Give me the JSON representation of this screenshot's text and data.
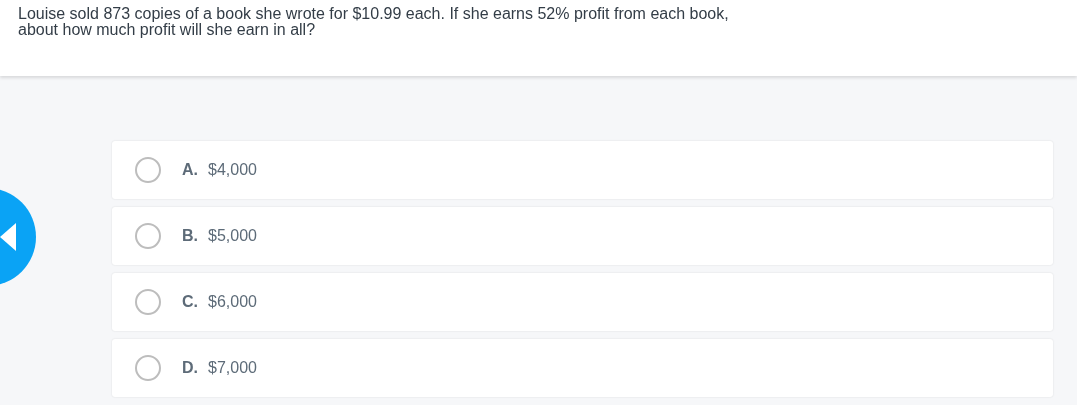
{
  "question": "Louise sold 873 copies of a book she wrote for $10.99 each. If she earns 52% profit from each book, about how much profit will she earn in all?",
  "options": [
    {
      "letter": "A.",
      "text": "$4,000",
      "selected": false
    },
    {
      "letter": "B.",
      "text": "$5,000",
      "selected": false
    },
    {
      "letter": "C.",
      "text": "$6,000",
      "selected": false
    },
    {
      "letter": "D.",
      "text": "$7,000",
      "selected": false
    }
  ]
}
